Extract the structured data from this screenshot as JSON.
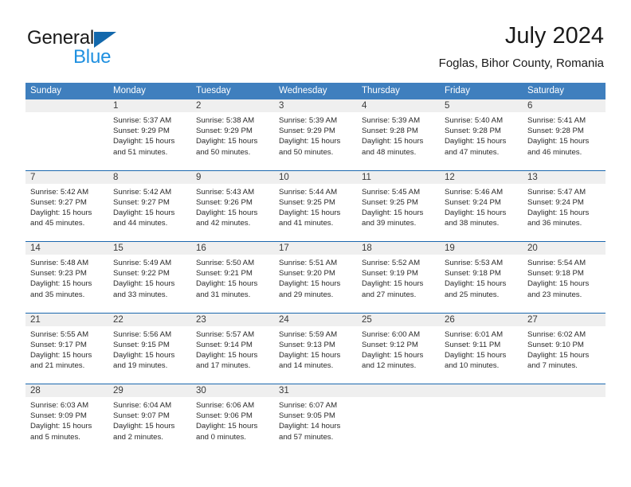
{
  "brand": {
    "name_part1": "General",
    "name_part2": "Blue",
    "triangle_icon": "triangle-icon",
    "accent_dark": "#1368ac",
    "accent_light": "#1f90e0"
  },
  "header": {
    "title": "July 2024",
    "subtitle": "Foglas, Bihor County, Romania"
  },
  "theme": {
    "header_row_bg": "#3f7fbe",
    "week_divider": "#1b68ae",
    "day_band_bg": "#efefef",
    "text": "#2a2a2a"
  },
  "weekdays": [
    "Sunday",
    "Monday",
    "Tuesday",
    "Wednesday",
    "Thursday",
    "Friday",
    "Saturday"
  ],
  "weeks": [
    [
      {
        "day": "",
        "lines": []
      },
      {
        "day": "1",
        "lines": [
          "Sunrise: 5:37 AM",
          "Sunset: 9:29 PM",
          "Daylight: 15 hours",
          "and 51 minutes."
        ]
      },
      {
        "day": "2",
        "lines": [
          "Sunrise: 5:38 AM",
          "Sunset: 9:29 PM",
          "Daylight: 15 hours",
          "and 50 minutes."
        ]
      },
      {
        "day": "3",
        "lines": [
          "Sunrise: 5:39 AM",
          "Sunset: 9:29 PM",
          "Daylight: 15 hours",
          "and 50 minutes."
        ]
      },
      {
        "day": "4",
        "lines": [
          "Sunrise: 5:39 AM",
          "Sunset: 9:28 PM",
          "Daylight: 15 hours",
          "and 48 minutes."
        ]
      },
      {
        "day": "5",
        "lines": [
          "Sunrise: 5:40 AM",
          "Sunset: 9:28 PM",
          "Daylight: 15 hours",
          "and 47 minutes."
        ]
      },
      {
        "day": "6",
        "lines": [
          "Sunrise: 5:41 AM",
          "Sunset: 9:28 PM",
          "Daylight: 15 hours",
          "and 46 minutes."
        ]
      }
    ],
    [
      {
        "day": "7",
        "lines": [
          "Sunrise: 5:42 AM",
          "Sunset: 9:27 PM",
          "Daylight: 15 hours",
          "and 45 minutes."
        ]
      },
      {
        "day": "8",
        "lines": [
          "Sunrise: 5:42 AM",
          "Sunset: 9:27 PM",
          "Daylight: 15 hours",
          "and 44 minutes."
        ]
      },
      {
        "day": "9",
        "lines": [
          "Sunrise: 5:43 AM",
          "Sunset: 9:26 PM",
          "Daylight: 15 hours",
          "and 42 minutes."
        ]
      },
      {
        "day": "10",
        "lines": [
          "Sunrise: 5:44 AM",
          "Sunset: 9:25 PM",
          "Daylight: 15 hours",
          "and 41 minutes."
        ]
      },
      {
        "day": "11",
        "lines": [
          "Sunrise: 5:45 AM",
          "Sunset: 9:25 PM",
          "Daylight: 15 hours",
          "and 39 minutes."
        ]
      },
      {
        "day": "12",
        "lines": [
          "Sunrise: 5:46 AM",
          "Sunset: 9:24 PM",
          "Daylight: 15 hours",
          "and 38 minutes."
        ]
      },
      {
        "day": "13",
        "lines": [
          "Sunrise: 5:47 AM",
          "Sunset: 9:24 PM",
          "Daylight: 15 hours",
          "and 36 minutes."
        ]
      }
    ],
    [
      {
        "day": "14",
        "lines": [
          "Sunrise: 5:48 AM",
          "Sunset: 9:23 PM",
          "Daylight: 15 hours",
          "and 35 minutes."
        ]
      },
      {
        "day": "15",
        "lines": [
          "Sunrise: 5:49 AM",
          "Sunset: 9:22 PM",
          "Daylight: 15 hours",
          "and 33 minutes."
        ]
      },
      {
        "day": "16",
        "lines": [
          "Sunrise: 5:50 AM",
          "Sunset: 9:21 PM",
          "Daylight: 15 hours",
          "and 31 minutes."
        ]
      },
      {
        "day": "17",
        "lines": [
          "Sunrise: 5:51 AM",
          "Sunset: 9:20 PM",
          "Daylight: 15 hours",
          "and 29 minutes."
        ]
      },
      {
        "day": "18",
        "lines": [
          "Sunrise: 5:52 AM",
          "Sunset: 9:19 PM",
          "Daylight: 15 hours",
          "and 27 minutes."
        ]
      },
      {
        "day": "19",
        "lines": [
          "Sunrise: 5:53 AM",
          "Sunset: 9:18 PM",
          "Daylight: 15 hours",
          "and 25 minutes."
        ]
      },
      {
        "day": "20",
        "lines": [
          "Sunrise: 5:54 AM",
          "Sunset: 9:18 PM",
          "Daylight: 15 hours",
          "and 23 minutes."
        ]
      }
    ],
    [
      {
        "day": "21",
        "lines": [
          "Sunrise: 5:55 AM",
          "Sunset: 9:17 PM",
          "Daylight: 15 hours",
          "and 21 minutes."
        ]
      },
      {
        "day": "22",
        "lines": [
          "Sunrise: 5:56 AM",
          "Sunset: 9:15 PM",
          "Daylight: 15 hours",
          "and 19 minutes."
        ]
      },
      {
        "day": "23",
        "lines": [
          "Sunrise: 5:57 AM",
          "Sunset: 9:14 PM",
          "Daylight: 15 hours",
          "and 17 minutes."
        ]
      },
      {
        "day": "24",
        "lines": [
          "Sunrise: 5:59 AM",
          "Sunset: 9:13 PM",
          "Daylight: 15 hours",
          "and 14 minutes."
        ]
      },
      {
        "day": "25",
        "lines": [
          "Sunrise: 6:00 AM",
          "Sunset: 9:12 PM",
          "Daylight: 15 hours",
          "and 12 minutes."
        ]
      },
      {
        "day": "26",
        "lines": [
          "Sunrise: 6:01 AM",
          "Sunset: 9:11 PM",
          "Daylight: 15 hours",
          "and 10 minutes."
        ]
      },
      {
        "day": "27",
        "lines": [
          "Sunrise: 6:02 AM",
          "Sunset: 9:10 PM",
          "Daylight: 15 hours",
          "and 7 minutes."
        ]
      }
    ],
    [
      {
        "day": "28",
        "lines": [
          "Sunrise: 6:03 AM",
          "Sunset: 9:09 PM",
          "Daylight: 15 hours",
          "and 5 minutes."
        ]
      },
      {
        "day": "29",
        "lines": [
          "Sunrise: 6:04 AM",
          "Sunset: 9:07 PM",
          "Daylight: 15 hours",
          "and 2 minutes."
        ]
      },
      {
        "day": "30",
        "lines": [
          "Sunrise: 6:06 AM",
          "Sunset: 9:06 PM",
          "Daylight: 15 hours",
          "and 0 minutes."
        ]
      },
      {
        "day": "31",
        "lines": [
          "Sunrise: 6:07 AM",
          "Sunset: 9:05 PM",
          "Daylight: 14 hours",
          "and 57 minutes."
        ]
      },
      {
        "day": "",
        "lines": []
      },
      {
        "day": "",
        "lines": []
      },
      {
        "day": "",
        "lines": []
      }
    ]
  ]
}
